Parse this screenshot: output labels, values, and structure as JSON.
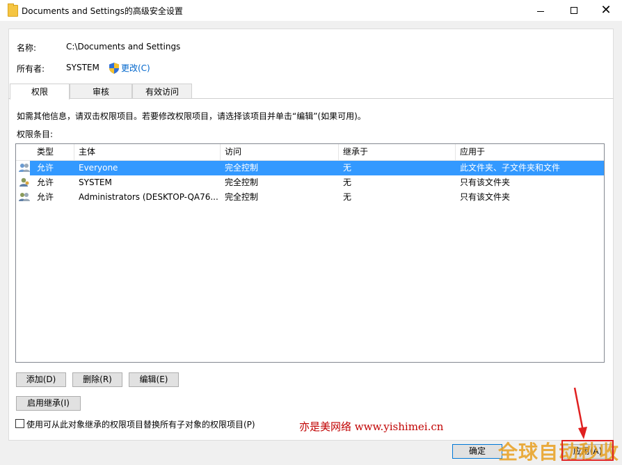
{
  "window": {
    "title": "Documents and Settings的高级安全设置"
  },
  "object": {
    "name_label": "名称:",
    "name_value": "C:\\Documents and Settings",
    "owner_label": "所有者:",
    "owner_value": "SYSTEM",
    "change_label": "更改(C)"
  },
  "tabs": [
    {
      "label": "权限",
      "active": true
    },
    {
      "label": "审核",
      "active": false
    },
    {
      "label": "有效访问",
      "active": false
    }
  ],
  "info_text": "如需其他信息，请双击权限项目。若要修改权限项目，请选择该项目并单击“编辑”(如果可用)。",
  "entries_label": "权限条目:",
  "table": {
    "columns": [
      "类型",
      "主体",
      "访问",
      "继承于",
      "应用于"
    ],
    "rows": [
      {
        "type": "允许",
        "principal": "Everyone",
        "access": "完全控制",
        "inherited": "无",
        "applies": "此文件夹、子文件夹和文件",
        "selected": true
      },
      {
        "type": "允许",
        "principal": "SYSTEM",
        "access": "完全控制",
        "inherited": "无",
        "applies": "只有该文件夹",
        "selected": false
      },
      {
        "type": "允许",
        "principal": "Administrators (DESKTOP-QA76...",
        "access": "完全控制",
        "inherited": "无",
        "applies": "只有该文件夹",
        "selected": false
      }
    ]
  },
  "buttons": {
    "add": "添加(D)",
    "remove": "删除(R)",
    "edit": "编辑(E)",
    "enable_inheritance": "启用继承(I)",
    "ok": "确定",
    "apply": "应用(A)"
  },
  "replace_checkbox": {
    "label": "使用可从此对象继承的权限项目替换所有子对象的权限项目(P)",
    "checked": false
  },
  "watermark": "亦是美网络 www.yishimei.cn",
  "logo_watermark": "全球自动秒收",
  "colors": {
    "selection": "#3399ff",
    "link": "#0066cc",
    "annotation": "#e02020"
  }
}
